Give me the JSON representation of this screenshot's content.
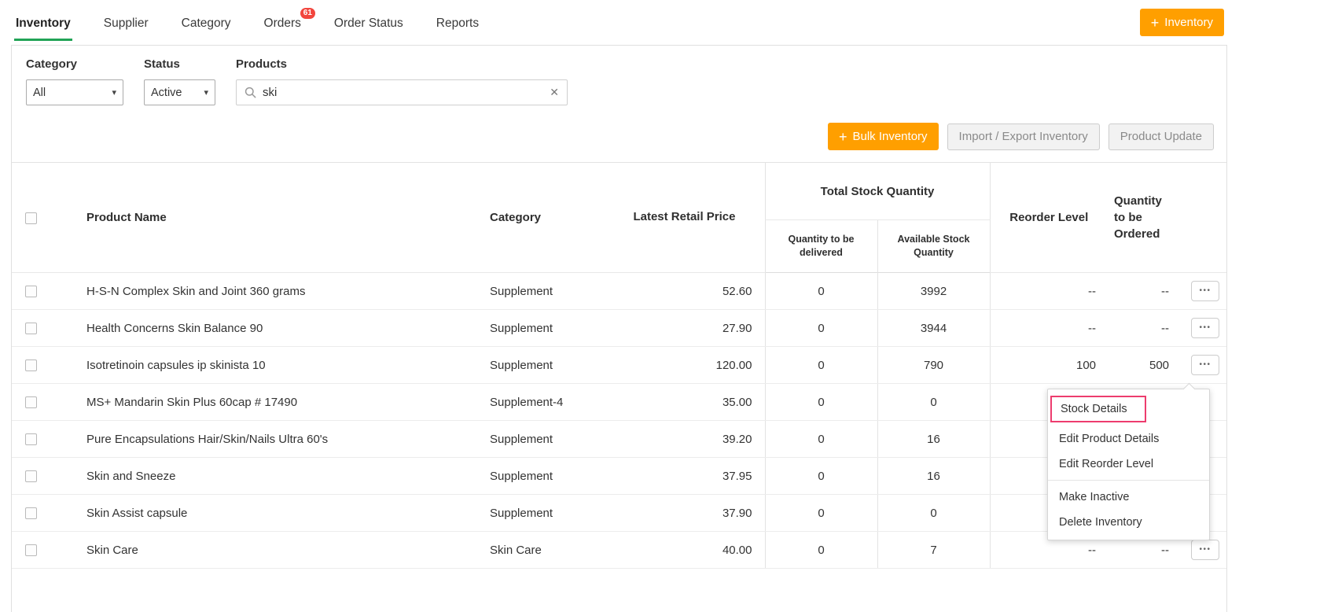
{
  "colors": {
    "accent_orange": "#ff9f00",
    "active_tab_green": "#21a356",
    "badge_red": "#f2453d",
    "menu_highlight_pink": "#ed3c6e"
  },
  "icons": {
    "plus": "+",
    "close": "✕",
    "ellipsis": "•••",
    "chevron": "▾"
  },
  "nav": {
    "items": [
      {
        "label": "Inventory",
        "active": true
      },
      {
        "label": "Supplier"
      },
      {
        "label": "Category"
      },
      {
        "label": "Orders",
        "badge": "61"
      },
      {
        "label": "Order Status"
      },
      {
        "label": "Reports"
      }
    ],
    "add_button_label": "Inventory"
  },
  "filters": {
    "category_label": "Category",
    "category_value": "All",
    "status_label": "Status",
    "status_value": "Active",
    "products_label": "Products",
    "search_value": "ski"
  },
  "toolbar": {
    "bulk_inventory": "Bulk Inventory",
    "import_export": "Import / Export Inventory",
    "product_update": "Product Update"
  },
  "table": {
    "headers": {
      "product_name": "Product Name",
      "category": "Category",
      "latest_retail_price": "Latest Retail Price",
      "total_stock_quantity": "Total Stock Quantity",
      "qty_to_be_delivered": "Quantity to be delivered",
      "available_stock_quantity": "Available Stock Quantity",
      "reorder_level": "Reorder Level",
      "qty_to_be_ordered": "Quantity to be Ordered"
    },
    "rows": [
      {
        "name": "H-S-N Complex Skin and Joint 360 grams",
        "category": "Supplement",
        "price": "52.60",
        "delivered": "0",
        "available": "3992",
        "reorder": "--",
        "to_order": "--"
      },
      {
        "name": "Health Concerns Skin Balance 90",
        "category": "Supplement",
        "price": "27.90",
        "delivered": "0",
        "available": "3944",
        "reorder": "--",
        "to_order": "--"
      },
      {
        "name": "Isotretinoin capsules ip skinista 10",
        "category": "Supplement",
        "price": "120.00",
        "delivered": "0",
        "available": "790",
        "reorder": "100",
        "to_order": "500"
      },
      {
        "name": "MS+ Mandarin Skin Plus 60cap # 17490",
        "category": "Supplement-4",
        "price": "35.00",
        "delivered": "0",
        "available": "0",
        "reorder": "",
        "to_order": ""
      },
      {
        "name": "Pure Encapsulations Hair/Skin/Nails Ultra 60's",
        "category": "Supplement",
        "price": "39.20",
        "delivered": "0",
        "available": "16",
        "reorder": "",
        "to_order": ""
      },
      {
        "name": "Skin and Sneeze",
        "category": "Supplement",
        "price": "37.95",
        "delivered": "0",
        "available": "16",
        "reorder": "",
        "to_order": ""
      },
      {
        "name": "Skin Assist capsule",
        "category": "Supplement",
        "price": "37.90",
        "delivered": "0",
        "available": "0",
        "reorder": "",
        "to_order": ""
      },
      {
        "name": "Skin Care",
        "category": "Skin Care",
        "price": "40.00",
        "delivered": "0",
        "available": "7",
        "reorder": "--",
        "to_order": "--"
      }
    ]
  },
  "context_menu": {
    "items": [
      "Stock Details",
      "Edit Product Details",
      "Edit Reorder Level",
      "Make Inactive",
      "Delete Inventory"
    ]
  }
}
